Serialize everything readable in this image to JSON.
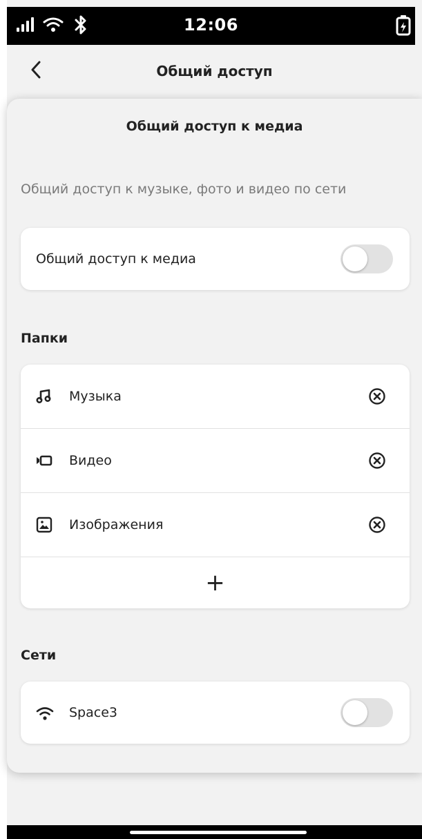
{
  "status_bar": {
    "time": "12:06",
    "icons": [
      "signal-icon",
      "wifi-icon",
      "bluetooth-icon",
      "battery-charging-icon"
    ]
  },
  "header": {
    "title": "Общий доступ",
    "back_icon": "chevron-left-icon"
  },
  "sheet": {
    "title": "Общий доступ к медиа",
    "subtitle": "Общий доступ к музыке, фото и видео по сети",
    "media_sharing": {
      "label": "Общий доступ к медиа",
      "enabled": false
    },
    "folders": {
      "section_label": "Папки",
      "items": [
        {
          "label": "Музыка",
          "icon": "music-note-icon"
        },
        {
          "label": "Видео",
          "icon": "video-camera-icon"
        },
        {
          "label": "Изображения",
          "icon": "image-icon"
        }
      ],
      "add_label": "+"
    },
    "networks": {
      "section_label": "Сети",
      "items": [
        {
          "label": "Space3",
          "icon": "wifi-icon",
          "enabled": false
        }
      ]
    }
  },
  "colors": {
    "background": "#f2f2f2",
    "card": "#ffffff",
    "toggle_off": "#e2e2e2",
    "status_bar": "#000000"
  }
}
